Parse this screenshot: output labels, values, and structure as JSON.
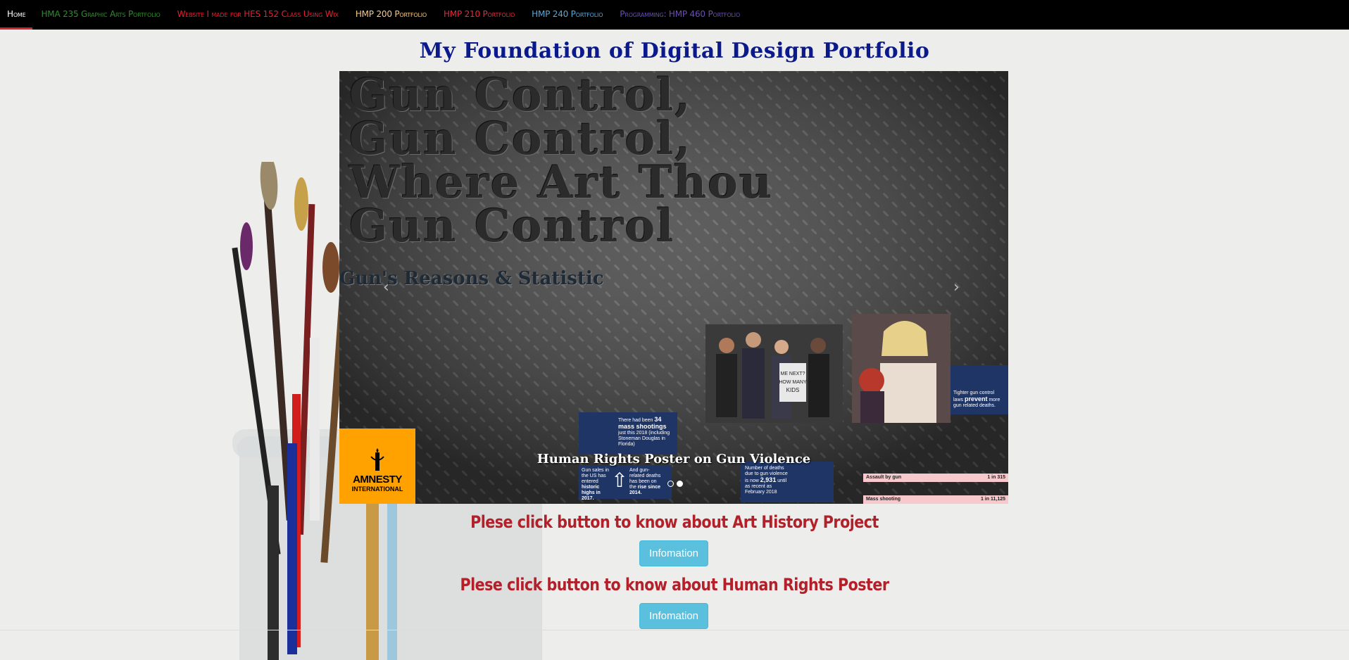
{
  "nav": {
    "items": [
      {
        "label": "Home",
        "color": "#ffffff",
        "active": true
      },
      {
        "label": "HMA 235 Graphic Arts Portfolio",
        "color": "#2e8b2e"
      },
      {
        "label": "Website I made for HES 152 Class Using Wix",
        "color": "#e3212f"
      },
      {
        "label": "HMP 200 Portfolio",
        "color": "#f6c98a"
      },
      {
        "label": "HMP 210 Portfolio",
        "color": "#e8283a"
      },
      {
        "label": "HMP 240 Portfolio",
        "color": "#5aa6d6"
      },
      {
        "label": "Programming: HMP 460 Portfolio",
        "color": "#6a4fb5"
      }
    ]
  },
  "title": "My Foundation of Digital Design Portfolio",
  "carousel": {
    "headline_lines": [
      "Gun Control,",
      "Gun Control,",
      "Where Art Thou",
      "Gun Control"
    ],
    "statistic_title": "Gun's Reasons & Statistic",
    "caption": "Human Rights Poster on Gun Violence",
    "prev_icon": "chevron-left-icon",
    "next_icon": "chevron-right-icon",
    "slide_count": 2,
    "active_slide": 2,
    "amnesty": {
      "line1": "AMNESTY",
      "line2": "INTERNATIONAL"
    },
    "info_boxes": {
      "mass_shootings": {
        "prefix": "There had been",
        "bold": "34 mass shootings",
        "suffix": "just this 2018 (including Stoneman Douglas in Florida)"
      },
      "gun_sales": {
        "text": "Gun sales in the US has entered",
        "bold": "historic highs in 2017."
      },
      "gun_deaths": {
        "text": "And gun-related deaths has been on the",
        "bold": "rise since 2014."
      },
      "deaths_count": {
        "text": "Number of deaths due to gun violence is now",
        "bold": "2,931",
        "suffix": "until as recent as February 2018"
      },
      "control": {
        "text": "Tighter gun control laws",
        "bold": "prevent",
        "suffix": "more gun related deaths."
      }
    },
    "stats": [
      {
        "label": "Assault by gun",
        "value": "1 in 315"
      },
      {
        "label": "Mass shooting",
        "value": "1 in 11,125"
      }
    ],
    "protest_sign": "ME NEXT? HOW MANY MORE KIDS HAVE TO DIE?"
  },
  "sections": [
    {
      "heading": "Plese click button to know about Art History Project",
      "button": "Infomation"
    },
    {
      "heading": "Plese click button to know about Human Rights Poster",
      "button": "Infomation"
    }
  ]
}
